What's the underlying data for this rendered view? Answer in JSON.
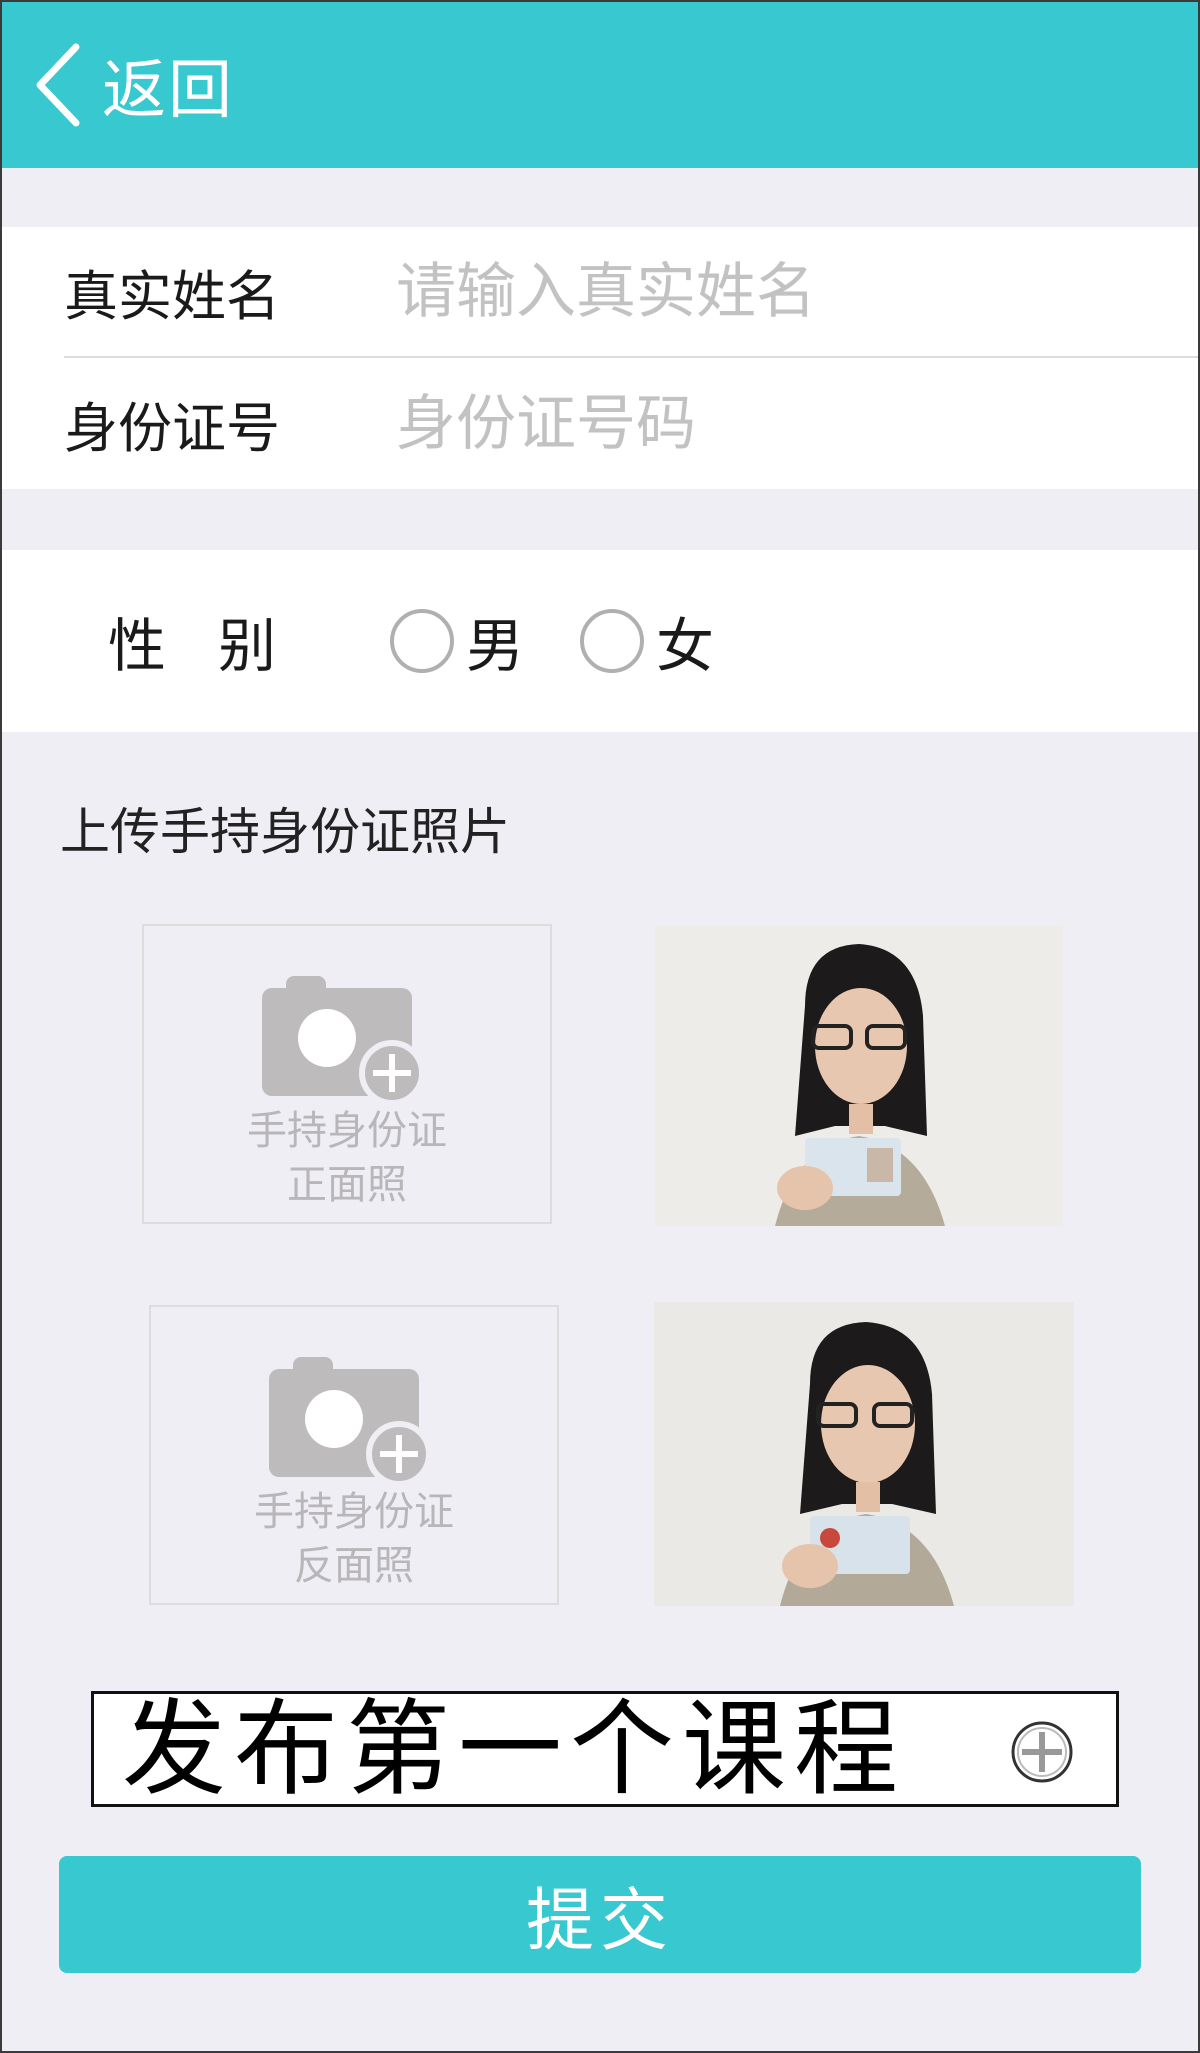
{
  "header": {
    "back_label": "返回"
  },
  "form": {
    "name": {
      "label": "真实姓名",
      "placeholder": "请输入真实姓名"
    },
    "id_number": {
      "label": "身份证号",
      "placeholder": "身份证号码"
    },
    "gender": {
      "label": "性别",
      "options": [
        "男",
        "女"
      ]
    }
  },
  "upload": {
    "title": "上传手持身份证照片",
    "front": {
      "line1": "手持身份证",
      "line2": "正面照"
    },
    "back": {
      "line1": "手持身份证",
      "line2": "反面照"
    }
  },
  "publish_button": {
    "label": "发布第一个课程"
  },
  "submit_button": {
    "label": "提交"
  },
  "colors": {
    "accent": "#38c8d0",
    "background": "#efeef4",
    "placeholder": "#c2c2c2"
  }
}
